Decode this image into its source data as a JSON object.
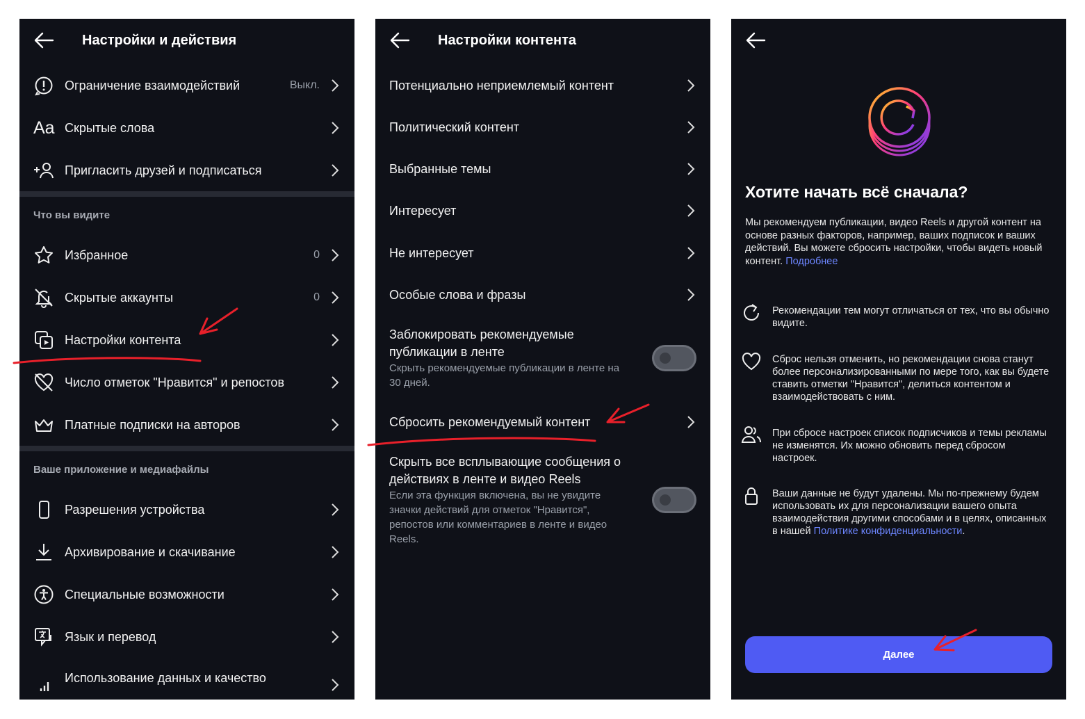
{
  "panel1": {
    "title": "Настройки и действия",
    "rows_top": [
      {
        "label": "Ограничение взаимодействий",
        "value": "Выкл.",
        "icon": "alert-circle-icon"
      },
      {
        "label": "Скрытые слова",
        "value": "",
        "icon": "font-aa-icon"
      },
      {
        "label": "Пригласить друзей и подписаться",
        "value": "",
        "icon": "add-person-icon"
      }
    ],
    "section1": "Что вы видите",
    "rows_mid": [
      {
        "label": "Избранное",
        "value": "0",
        "icon": "star-icon"
      },
      {
        "label": "Скрытые аккаунты",
        "value": "0",
        "icon": "muted-bell-icon"
      },
      {
        "label": "Настройки контента",
        "value": "",
        "icon": "content-settings-icon"
      },
      {
        "label": "Число отметок \"Нравится\" и репостов",
        "value": "",
        "icon": "heart-off-icon"
      },
      {
        "label": "Платные подписки на авторов",
        "value": "",
        "icon": "crown-icon"
      }
    ],
    "section2": "Ваше приложение и медиафайлы",
    "rows_bottom": [
      {
        "label": "Разрешения устройства",
        "value": "",
        "icon": "phone-icon"
      },
      {
        "label": "Архивирование и скачивание",
        "value": "",
        "icon": "download-icon"
      },
      {
        "label": "Специальные возможности",
        "value": "",
        "icon": "accessibility-icon"
      },
      {
        "label": "Язык и перевод",
        "value": "",
        "icon": "translate-icon"
      },
      {
        "label": "Использование данных и качество",
        "value": "",
        "icon": "signal-bars-icon"
      }
    ]
  },
  "panel2": {
    "title": "Настройки контента",
    "rows": [
      {
        "label": "Потенциально неприемлемый контент"
      },
      {
        "label": "Политический контент"
      },
      {
        "label": "Выбранные темы"
      },
      {
        "label": "Интересует"
      },
      {
        "label": "Не интересует"
      },
      {
        "label": "Особые слова и фразы"
      }
    ],
    "block_feed": {
      "title": "Заблокировать рекомендуемые публикации в ленте",
      "subtitle": "Скрыть рекомендуемые публикации в ленте на 30 дней.",
      "toggle_on": false
    },
    "reset_row": {
      "label": "Сбросить рекомендуемый контент"
    },
    "hide_popups": {
      "title": "Скрыть все всплывающие сообщения о действиях в ленте и видео Reels",
      "subtitle": "Если эта функция включена, вы не увидите значки действий для отметок \"Нравится\", репостов или комментариев в ленте и видео Reels.",
      "toggle_on": false
    }
  },
  "panel3": {
    "heading": "Хотите начать всё сначала?",
    "description": "Мы рекомендуем публикации, видео Reels и другой контент на основе разных факторов, например, ваших подписок и ваших действий. Вы можете сбросить настройки, чтобы видеть новый контент.",
    "description_link": "Подробнее",
    "items": [
      {
        "icon": "refresh-icon",
        "text": "Рекомендации тем могут отличаться от тех, что вы обычно видите."
      },
      {
        "icon": "heart-icon",
        "text": "Сброс нельзя отменить, но рекомендации снова станут более персонализированными по мере того, как вы будете ставить отметки \"Нравится\", делиться контентом и взаимодействовать с ним."
      },
      {
        "icon": "people-icon",
        "text": "При сбросе настроек список подписчиков и темы рекламы не изменятся. Их можно обновить перед сбросом настроек."
      },
      {
        "icon": "lock-icon",
        "text": "Ваши данные не будут удалены. Мы по-прежнему будем использовать их для персонализации вашего опыта взаимодействия другими способами и в целях, описанных в нашей",
        "link": "Политике конфиденциальности",
        "suffix": "."
      }
    ],
    "next_button": "Далее"
  },
  "colors": {
    "background": "#0f1118",
    "divider": "#272a33",
    "accent_button": "#4f5bf3",
    "link": "#6d86ff",
    "annotation": "#e8202a"
  }
}
